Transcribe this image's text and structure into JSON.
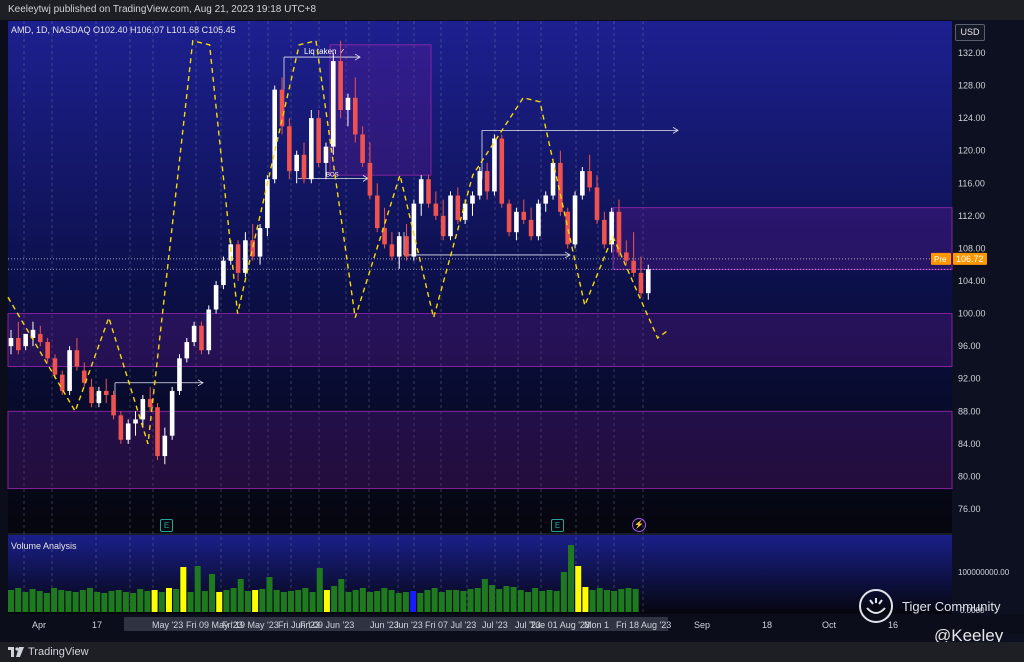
{
  "header": {
    "publisher": "Keeleytwj published on TradingView.com, Aug 21, 2023 19:18 UTC+8"
  },
  "footer": {
    "brand": "TradingView"
  },
  "legend": {
    "symbol_line": "AMD, 1D, NASDAQ  O102.40  H106.07  L101.68  C105.45"
  },
  "volume_panel": {
    "title": "Volume Analysis",
    "scale_labels": [
      "100000000.00",
      "0.0000"
    ]
  },
  "currency_button": "USD",
  "watermark": {
    "text": "Tiger Community",
    "handle": "@Keeley"
  },
  "event_badges": [
    "E",
    "E",
    "⚡"
  ],
  "colors": {
    "background_top": "#1d2090",
    "background_bottom": "#05060d",
    "up_candle": "#ffffff",
    "down_candle": "#ef5350",
    "zone_fill": "#6a1b9a",
    "zone_border": "#9c27b0",
    "projection": "#f5d90a",
    "price_tag": "#ff9800",
    "volume_green": "#1f7a1f",
    "volume_yellow": "#ffff00",
    "volume_blue": "#1a1aff"
  },
  "chart_data": {
    "type": "candlestick",
    "symbol": "AMD",
    "interval": "1D",
    "exchange": "NASDAQ",
    "ylim": [
      72,
      134
    ],
    "y_ticks": [
      "132.00",
      "128.00",
      "124.00",
      "120.00",
      "116.00",
      "112.00",
      "108.00",
      "104.00",
      "100.00",
      "96.00",
      "92.00",
      "88.00",
      "84.00",
      "80.00",
      "76.00"
    ],
    "x_ticks": [
      "Apr",
      "17",
      "May '23",
      "Fri 09 May '23",
      "Fri 19 May '23",
      "Fri Jun '23",
      "Fri 09 Jun '23",
      "Jun '23",
      "Jun '23",
      "Fri 07 Jul '23",
      "Jul '23",
      "Jul '23",
      "Tue 01 Aug '23",
      "Mon 1",
      "Fri 18 Aug '23",
      "Sep",
      "18",
      "Oct",
      "16"
    ],
    "current_price": {
      "label": "Pre",
      "value": "106.72"
    },
    "annotations": [
      {
        "text": "Liq taken ✓",
        "price": 131.5
      },
      {
        "text": "BOS",
        "price": 116.6
      }
    ],
    "zones": [
      {
        "from": 100.0,
        "to": 93.5
      },
      {
        "from": 88.0,
        "to": 78.5
      },
      {
        "from": 113.0,
        "to": 105.4
      },
      {
        "from": 133.0,
        "to": 117.0
      }
    ],
    "projection_path": [
      [
        0,
        102.0
      ],
      [
        12,
        88.0
      ],
      [
        18,
        99.5
      ],
      [
        25,
        84.0
      ],
      [
        33,
        133.5
      ],
      [
        36,
        133.0
      ],
      [
        41,
        100.0
      ],
      [
        52,
        133.0
      ],
      [
        55,
        133.5
      ],
      [
        62,
        99.5
      ],
      [
        70,
        117.0
      ],
      [
        76,
        99.5
      ],
      [
        83,
        117.0
      ],
      [
        92,
        126.5
      ],
      [
        95,
        126.0
      ],
      [
        103,
        101.0
      ],
      [
        108,
        109.5
      ],
      [
        116,
        97.0
      ],
      [
        118,
        98.0
      ]
    ],
    "ohlc": [
      [
        96,
        98,
        95,
        97
      ],
      [
        97,
        99,
        95,
        95.5
      ],
      [
        96,
        97.5,
        95.5,
        97.5
      ],
      [
        97,
        99,
        96,
        98
      ],
      [
        97.5,
        98.5,
        96,
        96.5
      ],
      [
        96.5,
        97,
        94,
        94.5
      ],
      [
        94.5,
        95,
        92,
        92.5
      ],
      [
        92.5,
        93,
        90,
        90.5
      ],
      [
        90.5,
        96,
        90,
        95.5
      ],
      [
        95.5,
        97,
        93,
        93.5
      ],
      [
        93,
        94,
        91,
        91.5
      ],
      [
        91,
        92,
        88.5,
        89
      ],
      [
        89,
        91,
        88.5,
        90.5
      ],
      [
        90.5,
        92,
        89,
        90
      ],
      [
        90,
        90.5,
        87,
        87.5
      ],
      [
        87.5,
        88,
        84,
        84.5
      ],
      [
        84.5,
        87,
        84,
        86.5
      ],
      [
        86.5,
        88,
        85,
        87
      ],
      [
        87,
        90,
        86,
        89.5
      ],
      [
        89.5,
        91,
        88,
        88.5
      ],
      [
        88.5,
        89,
        82,
        82.5
      ],
      [
        82.5,
        86,
        81.5,
        85
      ],
      [
        85,
        91,
        84.5,
        90.5
      ],
      [
        90.5,
        95,
        90,
        94.5
      ],
      [
        94.5,
        97,
        94,
        96.5
      ],
      [
        96.5,
        99,
        96,
        98.5
      ],
      [
        98.5,
        99,
        95,
        95.5
      ],
      [
        95.5,
        101,
        95,
        100.5
      ],
      [
        100.5,
        104,
        100,
        103.5
      ],
      [
        103.5,
        107,
        103,
        106.5
      ],
      [
        106.5,
        109,
        106,
        108.5
      ],
      [
        108.5,
        109,
        104,
        105
      ],
      [
        105,
        110,
        104.5,
        109
      ],
      [
        109,
        111,
        106.5,
        107
      ],
      [
        107,
        111,
        106,
        110.5
      ],
      [
        110.5,
        117,
        109.5,
        116.5
      ],
      [
        116.5,
        128,
        116,
        127.5
      ],
      [
        127.5,
        129,
        122,
        123
      ],
      [
        123,
        124,
        116.5,
        117.5
      ],
      [
        117.5,
        120,
        116,
        119.5
      ],
      [
        119.5,
        121,
        116,
        116.5
      ],
      [
        116.5,
        125,
        116,
        124
      ],
      [
        124,
        125,
        118,
        118.5
      ],
      [
        118.5,
        121,
        116.5,
        120.5
      ],
      [
        120.5,
        132,
        119.5,
        131
      ],
      [
        131,
        133.5,
        124,
        125
      ],
      [
        125,
        127,
        123,
        126.5
      ],
      [
        126.5,
        129,
        121,
        122
      ],
      [
        122,
        123,
        118,
        118.5
      ],
      [
        118.5,
        121,
        114,
        114.5
      ],
      [
        114.5,
        116,
        110,
        110.5
      ],
      [
        110.5,
        113,
        108,
        108.5
      ],
      [
        108.5,
        110,
        106.5,
        107
      ],
      [
        107,
        110,
        105.5,
        109.5
      ],
      [
        109.5,
        111,
        106.5,
        107
      ],
      [
        107,
        114,
        106.5,
        113.5
      ],
      [
        113.5,
        117,
        112,
        116.5
      ],
      [
        116.5,
        117,
        113,
        113.5
      ],
      [
        113.5,
        115,
        111.5,
        112
      ],
      [
        112,
        114,
        109,
        109.5
      ],
      [
        109.5,
        115,
        109,
        114.5
      ],
      [
        114.5,
        115.5,
        111,
        111.5
      ],
      [
        111.5,
        114,
        111,
        113.5
      ],
      [
        113.5,
        115,
        112,
        114.5
      ],
      [
        114.5,
        118,
        114,
        117.5
      ],
      [
        117.5,
        118.5,
        114,
        115
      ],
      [
        115,
        122,
        114.5,
        121.5
      ],
      [
        121.5,
        122,
        113,
        113.5
      ],
      [
        113.5,
        114,
        109.5,
        110
      ],
      [
        110,
        113,
        109,
        112.5
      ],
      [
        112.5,
        114,
        111,
        111.5
      ],
      [
        111.5,
        113,
        109,
        109.5
      ],
      [
        109.5,
        114,
        109,
        113.5
      ],
      [
        113.5,
        115,
        112.5,
        114.5
      ],
      [
        114.5,
        119,
        114,
        118.5
      ],
      [
        118.5,
        120,
        112,
        112.5
      ],
      [
        112.5,
        113,
        108,
        108.5
      ],
      [
        108.5,
        115,
        108,
        114.5
      ],
      [
        114.5,
        118,
        114,
        117.5
      ],
      [
        117.5,
        119.5,
        115,
        115.5
      ],
      [
        115.5,
        117,
        111,
        111.5
      ],
      [
        111.5,
        112.5,
        108,
        108.5
      ],
      [
        108.5,
        113,
        107.5,
        112.5
      ],
      [
        112.5,
        114,
        107,
        107.5
      ],
      [
        107.5,
        109,
        106,
        106.5
      ],
      [
        106.5,
        110,
        104.5,
        105
      ],
      [
        105,
        107,
        102,
        102.5
      ],
      [
        102.5,
        106,
        101.7,
        105.45
      ]
    ],
    "volume_flags": "ggggggggggggggggggggygygyggggyggggygggggggggygggggggggggbggggggggggggggggggggggyyggggggg"
  }
}
